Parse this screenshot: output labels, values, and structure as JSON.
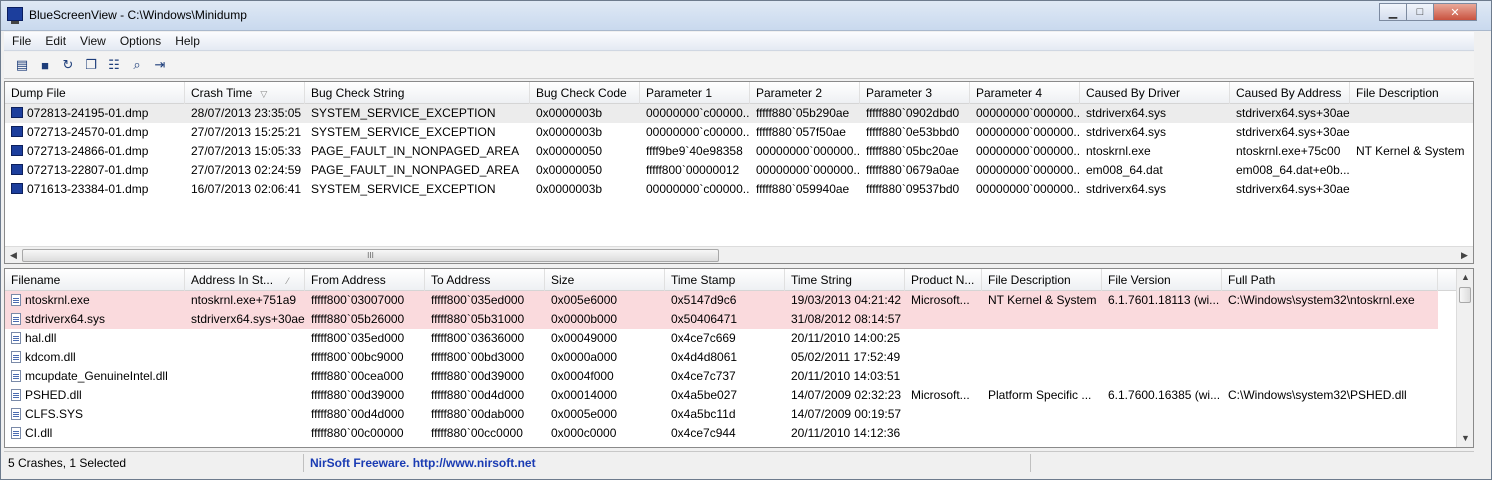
{
  "window": {
    "title": "BlueScreenView  -  C:\\Windows\\Minidump",
    "controls": {
      "minimize": "▁",
      "maximize": "□",
      "close": "✕"
    }
  },
  "menu": [
    "File",
    "Edit",
    "View",
    "Options",
    "Help"
  ],
  "toolbar": [
    {
      "icon": "html-report-icon",
      "glyph": "▤"
    },
    {
      "icon": "save-icon",
      "glyph": "■"
    },
    {
      "icon": "refresh-icon",
      "glyph": "↻"
    },
    {
      "icon": "copy-icon",
      "glyph": "❐"
    },
    {
      "icon": "properties-icon",
      "glyph": "☷"
    },
    {
      "icon": "find-icon",
      "glyph": "⌕"
    },
    {
      "icon": "exit-icon",
      "glyph": "⇥"
    }
  ],
  "crash_table": {
    "columns": [
      "Dump File",
      "Crash Time",
      "Bug Check String",
      "Bug Check Code",
      "Parameter 1",
      "Parameter 2",
      "Parameter 3",
      "Parameter 4",
      "Caused By Driver",
      "Caused By Address",
      "File Description"
    ],
    "sorted_column": "Crash Time",
    "sort_arrow": "▽",
    "rows": [
      [
        "072813-24195-01.dmp",
        "28/07/2013 23:35:05",
        "SYSTEM_SERVICE_EXCEPTION",
        "0x0000003b",
        "00000000`c00000...",
        "fffff880`05b290ae",
        "fffff880`0902dbd0",
        "00000000`000000...",
        "stdriverx64.sys",
        "stdriverx64.sys+30ae",
        ""
      ],
      [
        "072713-24570-01.dmp",
        "27/07/2013 15:25:21",
        "SYSTEM_SERVICE_EXCEPTION",
        "0x0000003b",
        "00000000`c00000...",
        "fffff880`057f50ae",
        "fffff880`0e53bbd0",
        "00000000`000000...",
        "stdriverx64.sys",
        "stdriverx64.sys+30ae",
        ""
      ],
      [
        "072713-24866-01.dmp",
        "27/07/2013 15:05:33",
        "PAGE_FAULT_IN_NONPAGED_AREA",
        "0x00000050",
        "ffff9be9`40e98358",
        "00000000`000000...",
        "fffff880`05bc20ae",
        "00000000`000000...",
        "ntoskrnl.exe",
        "ntoskrnl.exe+75c00",
        "NT Kernel & System"
      ],
      [
        "072713-22807-01.dmp",
        "27/07/2013 02:24:59",
        "PAGE_FAULT_IN_NONPAGED_AREA",
        "0x00000050",
        "fffff800`00000012",
        "00000000`000000...",
        "fffff880`0679a0ae",
        "00000000`000000...",
        "em008_64.dat",
        "em008_64.dat+e0b...",
        ""
      ],
      [
        "071613-23384-01.dmp",
        "16/07/2013 02:06:41",
        "SYSTEM_SERVICE_EXCEPTION",
        "0x0000003b",
        "00000000`c00000...",
        "fffff880`059940ae",
        "fffff880`09537bd0",
        "00000000`000000...",
        "stdriverx64.sys",
        "stdriverx64.sys+30ae",
        ""
      ]
    ],
    "selected_row": 0,
    "scroll_grip": "III"
  },
  "driver_table": {
    "columns": [
      "Filename",
      "Address In St...",
      "From Address",
      "To Address",
      "Size",
      "Time Stamp",
      "Time String",
      "Product N...",
      "File Description",
      "File Version",
      "Full Path"
    ],
    "sorted_column": "Address In St...",
    "sort_arrow": "⁄",
    "rows": [
      [
        "ntoskrnl.exe",
        "ntoskrnl.exe+751a9",
        "fffff800`03007000",
        "fffff800`035ed000",
        "0x005e6000",
        "0x5147d9c6",
        "19/03/2013 04:21:42",
        "Microsoft...",
        "NT Kernel & System",
        "6.1.7601.18113 (wi...",
        "C:\\Windows\\system32\\ntoskrnl.exe"
      ],
      [
        "stdriverx64.sys",
        "stdriverx64.sys+30ae",
        "fffff880`05b26000",
        "fffff880`05b31000",
        "0x0000b000",
        "0x50406471",
        "31/08/2012 08:14:57",
        "",
        "",
        "",
        ""
      ],
      [
        "hal.dll",
        "",
        "fffff800`035ed000",
        "fffff800`03636000",
        "0x00049000",
        "0x4ce7c669",
        "20/11/2010 14:00:25",
        "",
        "",
        "",
        ""
      ],
      [
        "kdcom.dll",
        "",
        "fffff800`00bc9000",
        "fffff800`00bd3000",
        "0x0000a000",
        "0x4d4d8061",
        "05/02/2011 17:52:49",
        "",
        "",
        "",
        ""
      ],
      [
        "mcupdate_GenuineIntel.dll",
        "",
        "fffff880`00cea000",
        "fffff880`00d39000",
        "0x0004f000",
        "0x4ce7c737",
        "20/11/2010 14:03:51",
        "",
        "",
        "",
        ""
      ],
      [
        "PSHED.dll",
        "",
        "fffff880`00d39000",
        "fffff880`00d4d000",
        "0x00014000",
        "0x4a5be027",
        "14/07/2009 02:32:23",
        "Microsoft...",
        "Platform Specific ...",
        "6.1.7600.16385 (wi...",
        "C:\\Windows\\system32\\PSHED.dll"
      ],
      [
        "CLFS.SYS",
        "",
        "fffff880`00d4d000",
        "fffff880`00dab000",
        "0x0005e000",
        "0x4a5bc11d",
        "14/07/2009 00:19:57",
        "",
        "",
        "",
        ""
      ],
      [
        "CI.dll",
        "",
        "fffff880`00c00000",
        "fffff880`00cc0000",
        "0x000c0000",
        "0x4ce7c944",
        "20/11/2010 14:12:36",
        "",
        "",
        "",
        ""
      ]
    ],
    "highlighted_rows": [
      0,
      1
    ]
  },
  "status": {
    "summary": "5 Crashes, 1 Selected",
    "credit": "NirSoft Freeware.  http://www.nirsoft.net"
  },
  "colors": {
    "selected_row": "#ececec",
    "highlight_row": "#fadadd",
    "link": "#1a3bb3"
  }
}
